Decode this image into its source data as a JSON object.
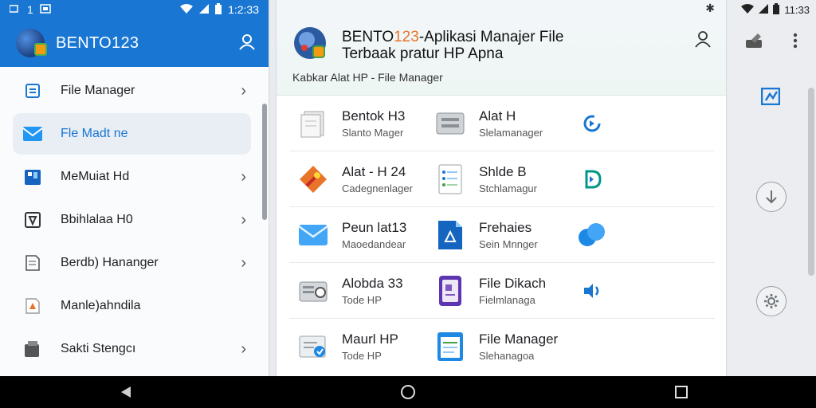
{
  "status_left": {
    "carrier_a": "1",
    "time": "1:2:33"
  },
  "status_right": {
    "time": "11:33"
  },
  "drawer": {
    "app_title": "BENTO123",
    "items": [
      {
        "label": "File Manager",
        "icon": "document-icon",
        "active": false
      },
      {
        "label": "Fle Madt ne",
        "icon": "mail-icon",
        "active": true
      },
      {
        "label": "MeMuiat Hd",
        "icon": "phone-icon",
        "active": false
      },
      {
        "label": "Bbihlalaa H0",
        "icon": "shield-icon",
        "active": false
      },
      {
        "label": "Berdb) Hananger",
        "icon": "note-icon",
        "active": false
      },
      {
        "label": "Manle)ahndila",
        "icon": "pdf-icon",
        "active": false
      },
      {
        "label": "Sakti Stengcı",
        "icon": "storage-icon",
        "active": false
      }
    ]
  },
  "dialog": {
    "title_prefix": "BENTO",
    "title_accent": "123",
    "title_rest": "-Aplikasi Manajer File",
    "title_line2": "Terbaak pratur HP Apna",
    "subtitle": "Kabkar Alat HP - File Manager",
    "rows": [
      {
        "left": {
          "title": "Bentok H3",
          "sub": "Slanto Mager",
          "icon": "papers-icon"
        },
        "right": {
          "title": "Alat H",
          "sub": "Slelamanager",
          "icon": "cabinet-icon"
        },
        "action_icon": "refresh-icon"
      },
      {
        "left": {
          "title": "Alat - H 24",
          "sub": "Cadegnenlager",
          "icon": "tools-icon"
        },
        "right": {
          "title": "Shlde B",
          "sub": "Stchlamagur",
          "icon": "checklist-icon"
        },
        "action_icon": "d-share-icon"
      },
      {
        "left": {
          "title": "Peun lat13",
          "sub": "Maoedandear",
          "icon": "envelope-icon"
        },
        "right": {
          "title": "Frehaies",
          "sub": "Sein Mnnger",
          "icon": "archive-icon"
        },
        "action_icon": "bubbles-icon"
      },
      {
        "left": {
          "title": "Alobda 33",
          "sub": "Tode HP",
          "icon": "printer-icon"
        },
        "right": {
          "title": "File Dikach",
          "sub": "Fielmlanaga",
          "icon": "tablet-icon"
        },
        "action_icon": "audio-icon"
      },
      {
        "left": {
          "title": "Maurl HP",
          "sub": "Tode HP",
          "icon": "folder-shield-icon"
        },
        "right": {
          "title": "File Manager",
          "sub": "Slehanagoa",
          "icon": "notepad-icon"
        },
        "action_icon": ""
      }
    ]
  },
  "colors": {
    "primary": "#1976d2",
    "accent": "#e8742a",
    "navbar": "#000000"
  }
}
